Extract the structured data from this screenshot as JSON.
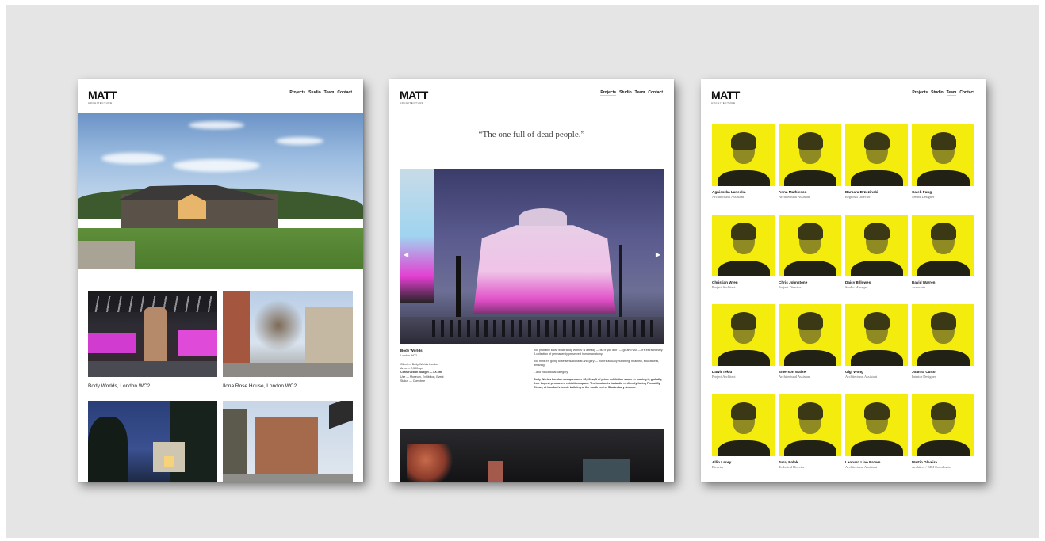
{
  "brand": {
    "logo": "MATT",
    "logo_sub": "ARCHITECTURE"
  },
  "nav": {
    "items": [
      "Projects",
      "Studio",
      "Team",
      "Contact"
    ]
  },
  "page_projects": {
    "captions": [
      "Body Worlds, London WC2",
      "Ilona Rose House, London WC2"
    ]
  },
  "page_project": {
    "quote": "“The one full of dead people.”",
    "title": "Body Worlds",
    "subtitle": "London WC2",
    "meta": [
      "Client — Body Worlds London",
      "Area — 2,500sqm",
      "Construction Budget — £X.5m",
      "Use — Museum, Exhibition, Event",
      "Status — Complete"
    ],
    "body": [
      "You probably know what ‘Body Worlds’ is already — but if you don’t — go and visit — it’s extraordinary. A collection of permanently preserved human anatomy.",
      "You think it’s going to be sensationalist and gory — but it’s actually humbling, beautiful, educational, amazing.",
      "...and educational category.",
      "Body Worlds London occupies over 30,000sqft of prime exhibition space — making it, globally, their largest permanent exhibition space. The location is fantastic — directly facing Piccadilly Circus, at London’s iconic building at the south end of Shaftesbury Avenue."
    ]
  },
  "page_team": {
    "members": [
      {
        "name": "Agnieszka Lanecka",
        "role": "Architectural Assistant"
      },
      {
        "name": "Anna Mathieson",
        "role": "Architectural Assistant"
      },
      {
        "name": "Barbara Brzezinski",
        "role": "Regional Director"
      },
      {
        "name": "Caleb Fung",
        "role": "Senior Designer"
      },
      {
        "name": "Christian Wren",
        "role": "Project Architect"
      },
      {
        "name": "Chris Johnstone",
        "role": "Project Director"
      },
      {
        "name": "Daisy Billowes",
        "role": "Studio Manager"
      },
      {
        "name": "David Warren",
        "role": "Associate"
      },
      {
        "name": "Dawit Teklu",
        "role": "Project Architect"
      },
      {
        "name": "Emerson Walker",
        "role": "Architectural Assistant"
      },
      {
        "name": "Gigi Wong",
        "role": "Architectural Assistant"
      },
      {
        "name": "Joanna Curto",
        "role": "Interior Designer"
      },
      {
        "name": "Allin Lacey",
        "role": "Director"
      },
      {
        "name": "Juraj Polak",
        "role": "Technical Director"
      },
      {
        "name": "Leonard Liao Brown",
        "role": "Architectural Assistant"
      },
      {
        "name": "Martin Oliveira",
        "role": "Architect / BIM Coordinator"
      }
    ]
  },
  "colors": {
    "accent": "#f2e600",
    "background": "#e5e5e5"
  }
}
